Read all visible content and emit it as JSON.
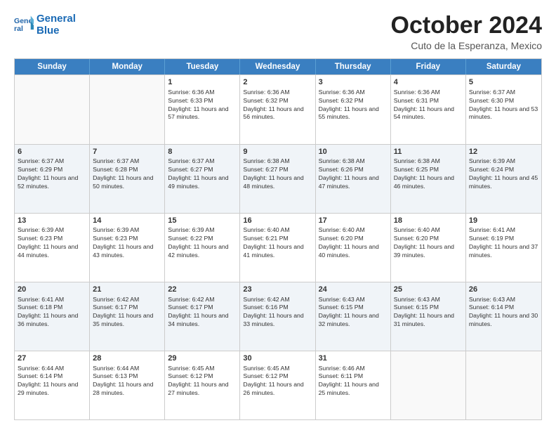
{
  "header": {
    "logo_line1": "General",
    "logo_line2": "Blue",
    "title": "October 2024",
    "subtitle": "Cuto de la Esperanza, Mexico"
  },
  "calendar": {
    "days_of_week": [
      "Sunday",
      "Monday",
      "Tuesday",
      "Wednesday",
      "Thursday",
      "Friday",
      "Saturday"
    ],
    "weeks": [
      [
        {
          "day": "",
          "info": ""
        },
        {
          "day": "",
          "info": ""
        },
        {
          "day": "1",
          "info": "Sunrise: 6:36 AM\nSunset: 6:33 PM\nDaylight: 11 hours and 57 minutes."
        },
        {
          "day": "2",
          "info": "Sunrise: 6:36 AM\nSunset: 6:32 PM\nDaylight: 11 hours and 56 minutes."
        },
        {
          "day": "3",
          "info": "Sunrise: 6:36 AM\nSunset: 6:32 PM\nDaylight: 11 hours and 55 minutes."
        },
        {
          "day": "4",
          "info": "Sunrise: 6:36 AM\nSunset: 6:31 PM\nDaylight: 11 hours and 54 minutes."
        },
        {
          "day": "5",
          "info": "Sunrise: 6:37 AM\nSunset: 6:30 PM\nDaylight: 11 hours and 53 minutes."
        }
      ],
      [
        {
          "day": "6",
          "info": "Sunrise: 6:37 AM\nSunset: 6:29 PM\nDaylight: 11 hours and 52 minutes."
        },
        {
          "day": "7",
          "info": "Sunrise: 6:37 AM\nSunset: 6:28 PM\nDaylight: 11 hours and 50 minutes."
        },
        {
          "day": "8",
          "info": "Sunrise: 6:37 AM\nSunset: 6:27 PM\nDaylight: 11 hours and 49 minutes."
        },
        {
          "day": "9",
          "info": "Sunrise: 6:38 AM\nSunset: 6:27 PM\nDaylight: 11 hours and 48 minutes."
        },
        {
          "day": "10",
          "info": "Sunrise: 6:38 AM\nSunset: 6:26 PM\nDaylight: 11 hours and 47 minutes."
        },
        {
          "day": "11",
          "info": "Sunrise: 6:38 AM\nSunset: 6:25 PM\nDaylight: 11 hours and 46 minutes."
        },
        {
          "day": "12",
          "info": "Sunrise: 6:39 AM\nSunset: 6:24 PM\nDaylight: 11 hours and 45 minutes."
        }
      ],
      [
        {
          "day": "13",
          "info": "Sunrise: 6:39 AM\nSunset: 6:23 PM\nDaylight: 11 hours and 44 minutes."
        },
        {
          "day": "14",
          "info": "Sunrise: 6:39 AM\nSunset: 6:23 PM\nDaylight: 11 hours and 43 minutes."
        },
        {
          "day": "15",
          "info": "Sunrise: 6:39 AM\nSunset: 6:22 PM\nDaylight: 11 hours and 42 minutes."
        },
        {
          "day": "16",
          "info": "Sunrise: 6:40 AM\nSunset: 6:21 PM\nDaylight: 11 hours and 41 minutes."
        },
        {
          "day": "17",
          "info": "Sunrise: 6:40 AM\nSunset: 6:20 PM\nDaylight: 11 hours and 40 minutes."
        },
        {
          "day": "18",
          "info": "Sunrise: 6:40 AM\nSunset: 6:20 PM\nDaylight: 11 hours and 39 minutes."
        },
        {
          "day": "19",
          "info": "Sunrise: 6:41 AM\nSunset: 6:19 PM\nDaylight: 11 hours and 37 minutes."
        }
      ],
      [
        {
          "day": "20",
          "info": "Sunrise: 6:41 AM\nSunset: 6:18 PM\nDaylight: 11 hours and 36 minutes."
        },
        {
          "day": "21",
          "info": "Sunrise: 6:42 AM\nSunset: 6:17 PM\nDaylight: 11 hours and 35 minutes."
        },
        {
          "day": "22",
          "info": "Sunrise: 6:42 AM\nSunset: 6:17 PM\nDaylight: 11 hours and 34 minutes."
        },
        {
          "day": "23",
          "info": "Sunrise: 6:42 AM\nSunset: 6:16 PM\nDaylight: 11 hours and 33 minutes."
        },
        {
          "day": "24",
          "info": "Sunrise: 6:43 AM\nSunset: 6:15 PM\nDaylight: 11 hours and 32 minutes."
        },
        {
          "day": "25",
          "info": "Sunrise: 6:43 AM\nSunset: 6:15 PM\nDaylight: 11 hours and 31 minutes."
        },
        {
          "day": "26",
          "info": "Sunrise: 6:43 AM\nSunset: 6:14 PM\nDaylight: 11 hours and 30 minutes."
        }
      ],
      [
        {
          "day": "27",
          "info": "Sunrise: 6:44 AM\nSunset: 6:14 PM\nDaylight: 11 hours and 29 minutes."
        },
        {
          "day": "28",
          "info": "Sunrise: 6:44 AM\nSunset: 6:13 PM\nDaylight: 11 hours and 28 minutes."
        },
        {
          "day": "29",
          "info": "Sunrise: 6:45 AM\nSunset: 6:12 PM\nDaylight: 11 hours and 27 minutes."
        },
        {
          "day": "30",
          "info": "Sunrise: 6:45 AM\nSunset: 6:12 PM\nDaylight: 11 hours and 26 minutes."
        },
        {
          "day": "31",
          "info": "Sunrise: 6:46 AM\nSunset: 6:11 PM\nDaylight: 11 hours and 25 minutes."
        },
        {
          "day": "",
          "info": ""
        },
        {
          "day": "",
          "info": ""
        }
      ]
    ]
  }
}
